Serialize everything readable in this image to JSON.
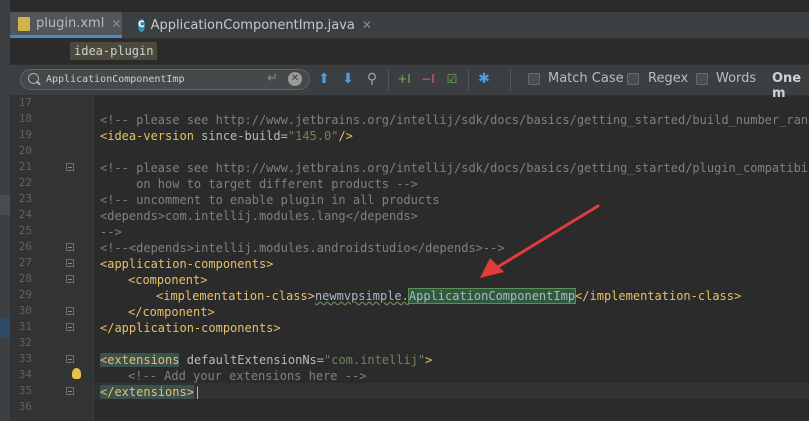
{
  "tabs": [
    {
      "label": "plugin.xml",
      "icon": "xml-file-icon",
      "active": true
    },
    {
      "label": "ApplicationComponentImp.java",
      "icon": "java-class-icon",
      "active": false
    }
  ],
  "breadcrumb": "idea-plugin",
  "find": {
    "value": "ApplicationComponentImp",
    "match_case_label": "Match Case",
    "regex_label": "Regex",
    "words_label": "Words",
    "result_label": "One m"
  },
  "line_numbers": [
    "17",
    "18",
    "19",
    "20",
    "21",
    "22",
    "23",
    "24",
    "25",
    "26",
    "27",
    "28",
    "29",
    "30",
    "31",
    "32",
    "33",
    "34",
    "35",
    "36"
  ],
  "code": {
    "l18_comment": "<!-- please see http://www.jetbrains.org/intellij/sdk/docs/basics/getting_started/build_number_ranges",
    "l19_tag_open": "<idea-version",
    "l19_attr": "since-build",
    "l19_eq": "=",
    "l19_val": "\"145.0\"",
    "l19_tag_close": "/>",
    "l21_comment": "<!-- please see http://www.jetbrains.org/intellij/sdk/docs/basics/getting_started/plugin_compatibility",
    "l22_comment": "     on how to target different products -->",
    "l23_comment": "<!-- uncomment to enable plugin in all products",
    "l24_comment": "<depends>com.intellij.modules.lang</depends>",
    "l25_comment": "-->",
    "l26_comment": "<!--<depends>intellij.modules.androidstudio</depends>-->",
    "l27_tag": "<application-components>",
    "l28_tag": "<component>",
    "l29_tag_open": "<implementation-class>",
    "l29_text": "newmvpsimple.",
    "l29_match": "ApplicationComponentImp",
    "l29_tag_close": "</implementation-class>",
    "l30_tag": "</component>",
    "l31_tag": "</application-components>",
    "l33_tag_open": "<extensions",
    "l33_attr": "defaultExtensionNs",
    "l33_eq": "=",
    "l33_val": "\"com.intellij\"",
    "l33_gt": ">",
    "l34_comment": "<!-- Add your extensions here -->",
    "l35_tag": "</extensions>"
  },
  "colors": {
    "background": "#2b2b2b",
    "tag": "#e8bf6a",
    "comment": "#808080",
    "string": "#6a8759",
    "search_highlight": "#32593d",
    "arrow": "#e03c3c"
  }
}
